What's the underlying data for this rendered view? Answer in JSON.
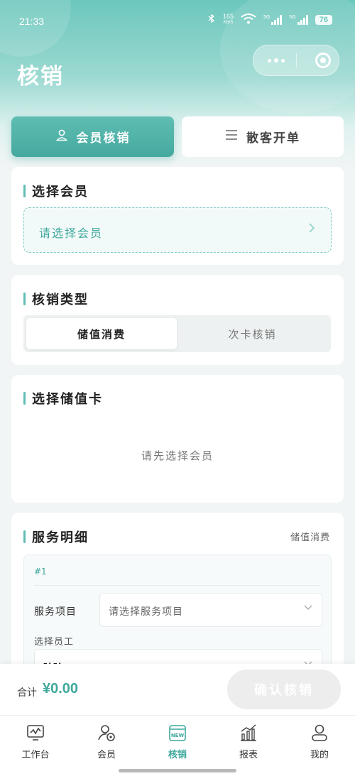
{
  "status_bar": {
    "time": "21:33",
    "net_speed": "165",
    "net_unit": "KB/S",
    "network": "5G",
    "battery": "76"
  },
  "page_title": "核销",
  "mode_tabs": [
    {
      "label": "会员核销",
      "icon": "person-icon",
      "active": true
    },
    {
      "label": "散客开单",
      "icon": "list-icon",
      "active": false
    }
  ],
  "select_member": {
    "title": "选择会员",
    "placeholder": "请选择会员"
  },
  "writeoff_type": {
    "title": "核销类型",
    "options": [
      "储值消费",
      "次卡核销"
    ],
    "selected": "储值消费"
  },
  "stored_card": {
    "title": "选择储值卡",
    "empty_hint": "请先选择会员"
  },
  "service_detail": {
    "title": "服务明细",
    "tag": "储值消费",
    "items": [
      {
        "no": "#1",
        "service_label": "服务项目",
        "service_placeholder": "请选择服务项目",
        "staff_label": "选择员工",
        "staff_value": "玲玲"
      }
    ]
  },
  "footer": {
    "total_label": "合计",
    "total_amount": "¥0.00",
    "confirm_label": "确认核销"
  },
  "tabbar": [
    {
      "label": "工作台",
      "icon": "workbench-icon"
    },
    {
      "label": "会员",
      "icon": "member-icon"
    },
    {
      "label": "核销",
      "icon": "new-writeoff-icon",
      "active": true
    },
    {
      "label": "报表",
      "icon": "report-icon"
    },
    {
      "label": "我的",
      "icon": "profile-icon"
    }
  ],
  "colors": {
    "accent": "#5fbdb3",
    "accent_dark": "#3fa89d",
    "background": "#f2f5f5"
  }
}
